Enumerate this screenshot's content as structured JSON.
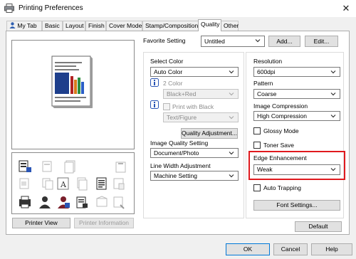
{
  "window": {
    "title": "Printing Preferences",
    "close_glyph": "✕"
  },
  "tabs": [
    {
      "label": "My Tab"
    },
    {
      "label": "Basic"
    },
    {
      "label": "Layout"
    },
    {
      "label": "Finish"
    },
    {
      "label": "Cover Mode"
    },
    {
      "label": "Stamp/Composition"
    },
    {
      "label": "Quality"
    },
    {
      "label": "Other"
    }
  ],
  "active_tab": "Quality",
  "favorite": {
    "label": "Favorite Setting",
    "value": "Untitled",
    "add_label": "Add...",
    "edit_label": "Edit..."
  },
  "left_buttons": {
    "printer_view": "Printer View",
    "printer_information": "Printer Information"
  },
  "color": {
    "select_color_label": "Select Color",
    "select_color_value": "Auto Color",
    "two_color_label": "2 Color",
    "two_color_value": "Black+Red",
    "print_with_black_label": "Print with Black",
    "print_with_black_value": "Text/Figure",
    "quality_adjustment_button": "Quality Adjustment..."
  },
  "image_quality": {
    "label": "Image Quality Setting",
    "value": "Document/Photo"
  },
  "line_width": {
    "label": "Line Width Adjustment",
    "value": "Machine Setting"
  },
  "resolution": {
    "label": "Resolution",
    "value": "600dpi"
  },
  "pattern": {
    "label": "Pattern",
    "value": "Coarse"
  },
  "image_compression": {
    "label": "Image Compression",
    "value": "High Compression"
  },
  "glossy_mode": {
    "label": "Glossy Mode",
    "checked": false
  },
  "toner_save": {
    "label": "Toner Save",
    "checked": false
  },
  "edge_enhancement": {
    "label": "Edge Enhancement",
    "value": "Weak"
  },
  "auto_trapping": {
    "label": "Auto Trapping",
    "checked": false
  },
  "font_settings_button": "Font Settings...",
  "default_button": "Default",
  "footer": {
    "ok": "OK",
    "cancel": "Cancel",
    "help": "Help"
  },
  "colors": {
    "accent_blue": "#0078d7",
    "highlight_red": "#e0191e"
  }
}
